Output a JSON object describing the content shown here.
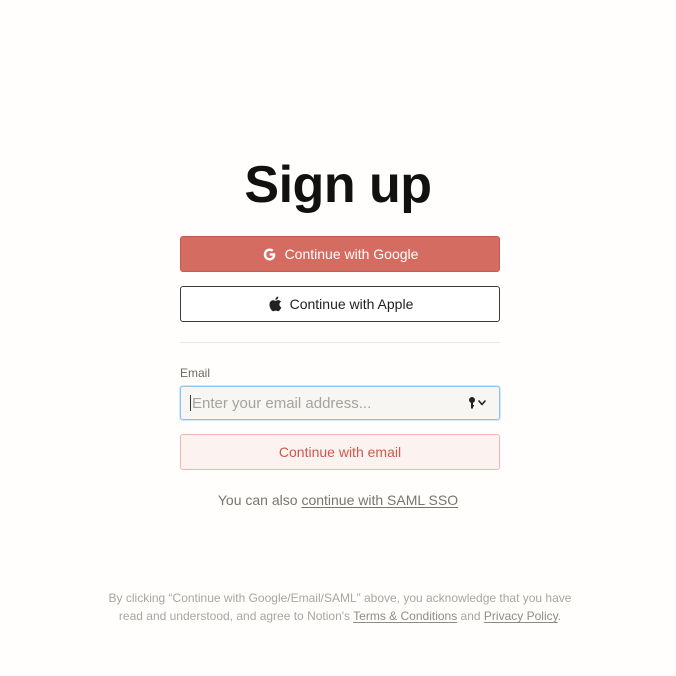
{
  "page": {
    "title": "Sign up"
  },
  "auth": {
    "google_label": "Continue with Google",
    "apple_label": "Continue with Apple",
    "email_label": "Email",
    "email_placeholder": "Enter your email address...",
    "email_value": "",
    "email_button_label": "Continue with email",
    "saml_prefix": "You can also ",
    "saml_link": "continue with SAML SSO"
  },
  "legal": {
    "line1": "By clicking “Continue with Google/Email/SAML” above, you acknowledge that you have",
    "line2_prefix": "read and understood, and agree to Notion's ",
    "terms_link": "Terms & Conditions",
    "and_text": " and ",
    "privacy_link": "Privacy Policy",
    "period": "."
  },
  "icons": {
    "google": "google-icon",
    "apple": "apple-icon",
    "password_manager": "key-icon"
  },
  "colors": {
    "google_button": "#d56c61",
    "email_button_text": "#cf574b",
    "email_button_bg": "#fcf3f1",
    "focus_ring": "#8fc4e6"
  }
}
